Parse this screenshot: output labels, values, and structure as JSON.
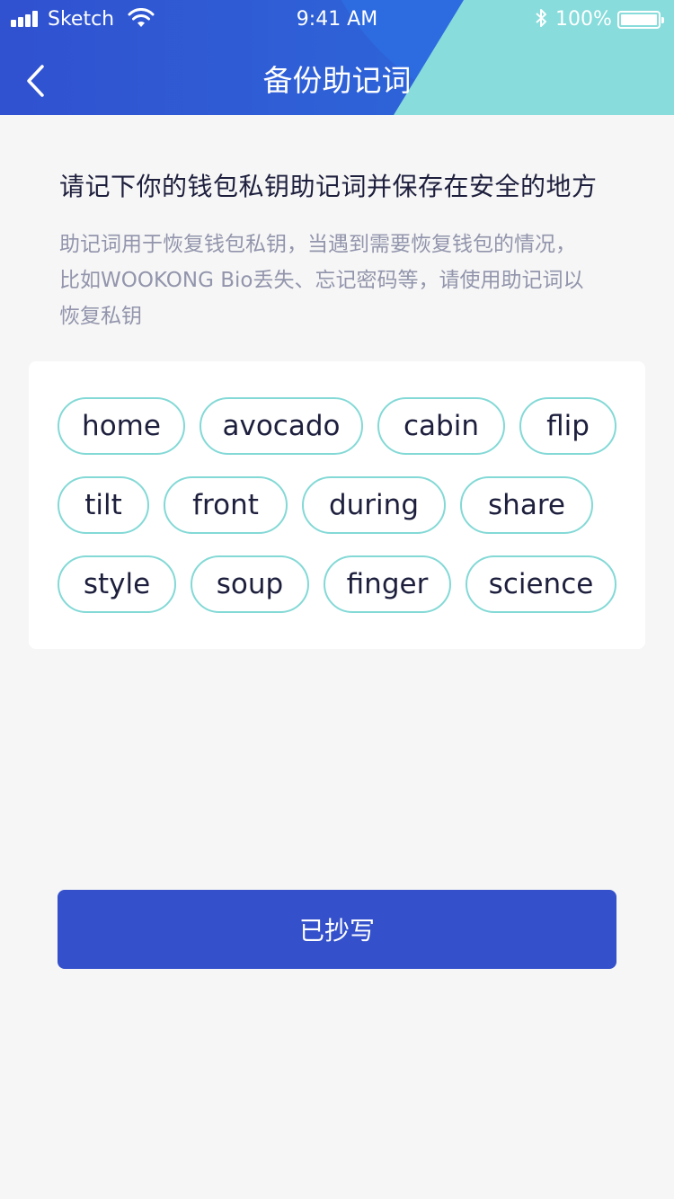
{
  "status_bar": {
    "carrier": "Sketch",
    "time": "9:41 AM",
    "battery": "100%"
  },
  "nav": {
    "title": "备份助记词",
    "back_icon": "chevron-left-icon"
  },
  "intro": {
    "heading": "请记下你的钱包私钥助记词并保存在安全的地方",
    "description_lines": [
      "助记词用于恢复钱包私钥，当遇到需要恢复钱包的情况，",
      "比如WOOKONG Bio丢失、忘记密码等，请使用助记词以",
      "恢复私钥"
    ]
  },
  "mnemonic": {
    "words": [
      "home",
      "avocado",
      "cabin",
      "flip",
      "tilt",
      "front",
      "during",
      "share",
      "style",
      "soup",
      "finger",
      "science"
    ]
  },
  "actions": {
    "confirm_label": "已抄写"
  },
  "colors": {
    "header_blue": "#3051d0",
    "header_teal": "#88dcdc",
    "word_border": "#83d9d6",
    "button": "#3451cb",
    "background": "#f6f6f6"
  }
}
